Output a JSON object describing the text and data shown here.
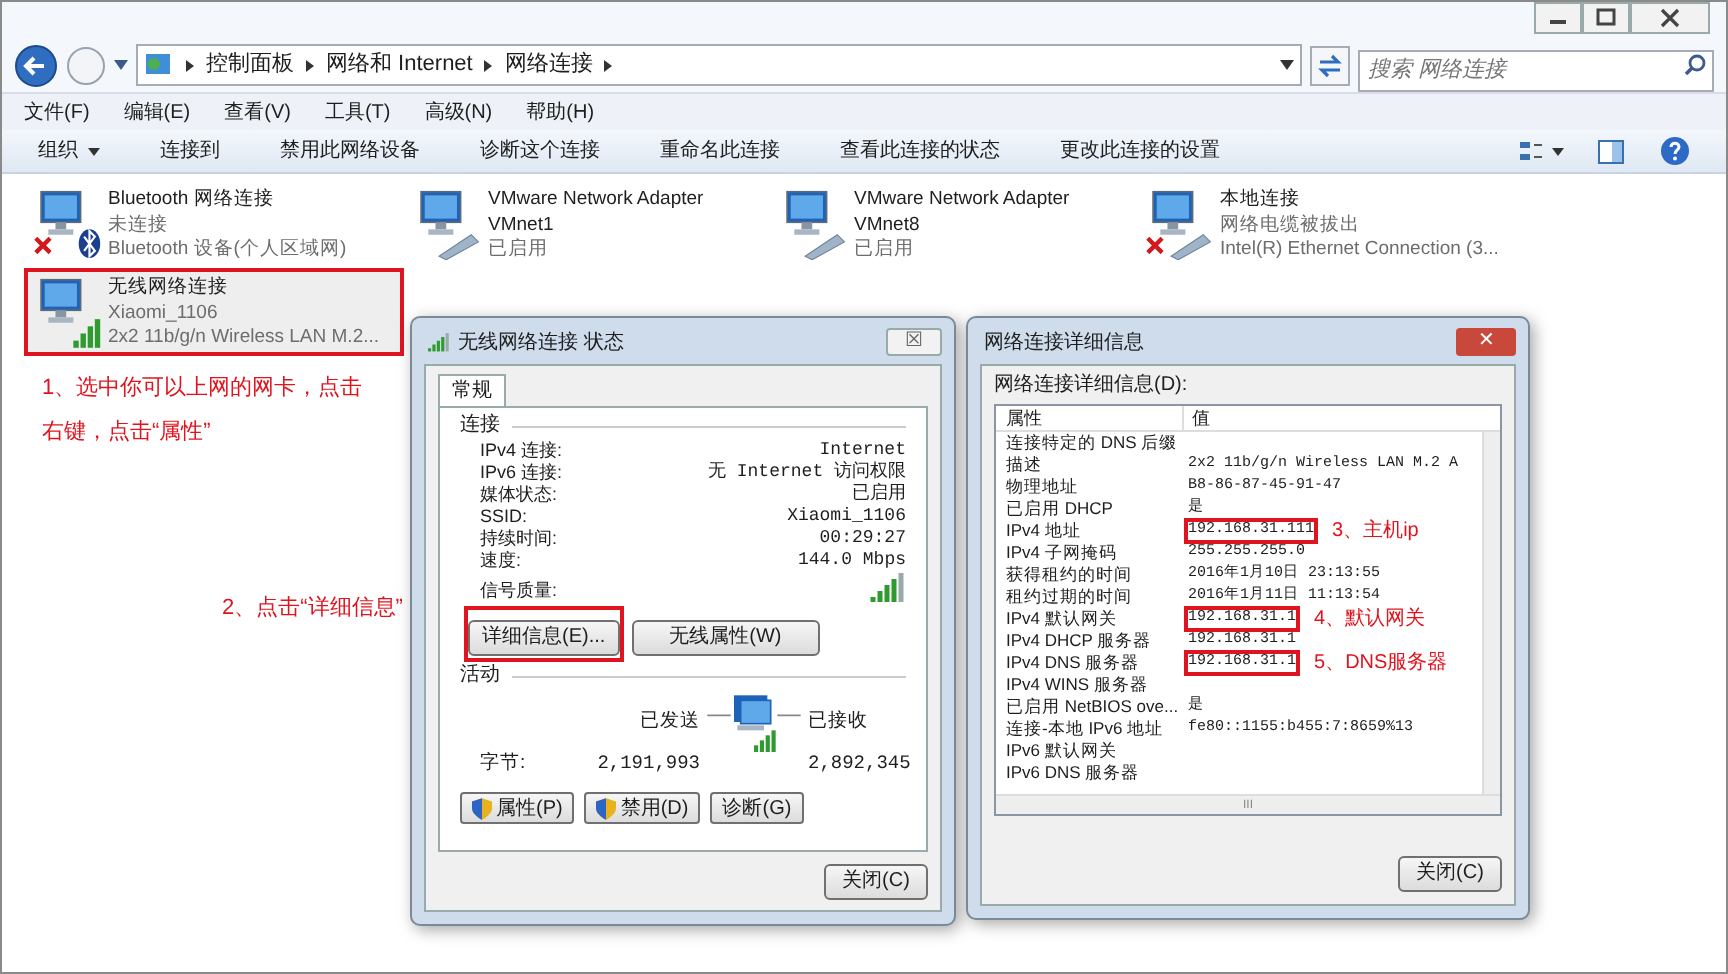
{
  "address": {
    "crumbs": [
      "控制面板",
      "网络和 Internet",
      "网络连接"
    ],
    "search_placeholder": "搜索 网络连接"
  },
  "menu": [
    "文件(F)",
    "编辑(E)",
    "查看(V)",
    "工具(T)",
    "高级(N)",
    "帮助(H)"
  ],
  "toolbar": [
    {
      "label": "组织",
      "kind": "dropdown"
    },
    {
      "label": "连接到",
      "kind": "plain"
    },
    {
      "label": "禁用此网络设备",
      "kind": "plain"
    },
    {
      "label": "诊断这个连接",
      "kind": "plain"
    },
    {
      "label": "重命名此连接",
      "kind": "plain"
    },
    {
      "label": "查看此连接的状态",
      "kind": "plain"
    },
    {
      "label": "更改此连接的设置",
      "kind": "plain"
    }
  ],
  "connections": [
    {
      "name": "Bluetooth 网络连接",
      "status": "未连接",
      "device": "Bluetooth 设备(个人区域网)",
      "kind": "bluetooth",
      "disconnected": true,
      "highlighted": false
    },
    {
      "name": "VMware Network Adapter VMnet1",
      "status": "已启用",
      "kind": "wired",
      "disconnected": false,
      "highlighted": false
    },
    {
      "name": "VMware Network Adapter VMnet8",
      "status": "已启用",
      "kind": "wired",
      "disconnected": false,
      "highlighted": false
    },
    {
      "name": "本地连接",
      "status": "网络电缆被拔出",
      "device": "Intel(R) Ethernet Connection (3...",
      "kind": "wired",
      "disconnected": true,
      "highlighted": false
    },
    {
      "name": "无线网络连接",
      "status": "Xiaomi_1106",
      "device": "2x2 11b/g/n Wireless LAN M.2...",
      "kind": "wireless",
      "disconnected": false,
      "highlighted": true
    }
  ],
  "status_dialog": {
    "title": "无线网络连接 状态",
    "close_glyph": "☒",
    "tabs": [
      {
        "label": "常规",
        "selected": true
      }
    ],
    "connection_heading": "连接",
    "rows": [
      {
        "label": "IPv4 连接:",
        "value": "Internet"
      },
      {
        "label": "IPv6 连接:",
        "value": "无 Internet 访问权限"
      },
      {
        "label": "媒体状态:",
        "value": "已启用"
      },
      {
        "label": "SSID:",
        "value": "Xiaomi_1106"
      },
      {
        "label": "持续时间:",
        "value": "00:29:27"
      },
      {
        "label": "速度:",
        "value": "144.0 Mbps"
      },
      {
        "label": "信号质量:",
        "kind": "signal"
      }
    ],
    "buttons": [
      {
        "label": "详细信息(E)...",
        "highlighted": true
      },
      {
        "label": "无线属性(W)",
        "highlighted": false
      }
    ],
    "activity_heading": "活动",
    "sent": "已发送",
    "received": "已接收",
    "bytes_label": "字节:",
    "bytes_sent": "2,191,993",
    "bytes_received": "2,892,345",
    "action_buttons": [
      {
        "label": "属性(P)",
        "shield": true
      },
      {
        "label": "禁用(D)",
        "shield": true
      },
      {
        "label": "诊断(G)",
        "shield": false
      }
    ],
    "close_button": "关闭(C)"
  },
  "details_dialog": {
    "title": "网络连接详细信息",
    "close_glyph": "✕",
    "list_label": "网络连接详细信息(D):",
    "columns": [
      "属性",
      "值"
    ],
    "rows": [
      {
        "property": "连接特定的 DNS 后缀",
        "highlighted": false
      },
      {
        "property": "描述",
        "value": "2x2 11b/g/n Wireless LAN M.2 A",
        "highlighted": false
      },
      {
        "property": "物理地址",
        "value": "B8-86-87-45-91-47",
        "highlighted": false
      },
      {
        "property": "已启用 DHCP",
        "value": "是",
        "highlighted": false
      },
      {
        "property": "IPv4 地址",
        "value": "192.168.31.111",
        "highlighted": true,
        "note": "3、主机ip"
      },
      {
        "property": "IPv4 子网掩码",
        "value": "255.255.255.0",
        "highlighted": false
      },
      {
        "property": "获得租约的时间",
        "value": "2016年1月10日 23:13:55",
        "highlighted": false
      },
      {
        "property": "租约过期的时间",
        "value": "2016年1月11日 11:13:54",
        "highlighted": false
      },
      {
        "property": "IPv4 默认网关",
        "value": "192.168.31.1",
        "highlighted": true,
        "note": "4、默认网关"
      },
      {
        "property": "IPv4 DHCP 服务器",
        "value": "192.168.31.1",
        "highlighted": false
      },
      {
        "property": "IPv4 DNS 服务器",
        "value": "192.168.31.1",
        "highlighted": true,
        "note": "5、DNS服务器"
      },
      {
        "property": "IPv4 WINS 服务器",
        "highlighted": false
      },
      {
        "property": "已启用 NetBIOS ove...",
        "value": "是",
        "highlighted": false
      },
      {
        "property": "连接-本地 IPv6 地址",
        "value": "fe80::1155:b455:7:8659%13",
        "highlighted": false
      },
      {
        "property": "IPv6 默认网关",
        "highlighted": false
      },
      {
        "property": "IPv6 DNS 服务器",
        "highlighted": false
      }
    ],
    "scroll_mark": "III",
    "close_button": "关闭(C)"
  },
  "annotations": [
    "1、选中你可以上网的网卡，点击右键，点击“属性”",
    "2、点击“详细信息”"
  ]
}
